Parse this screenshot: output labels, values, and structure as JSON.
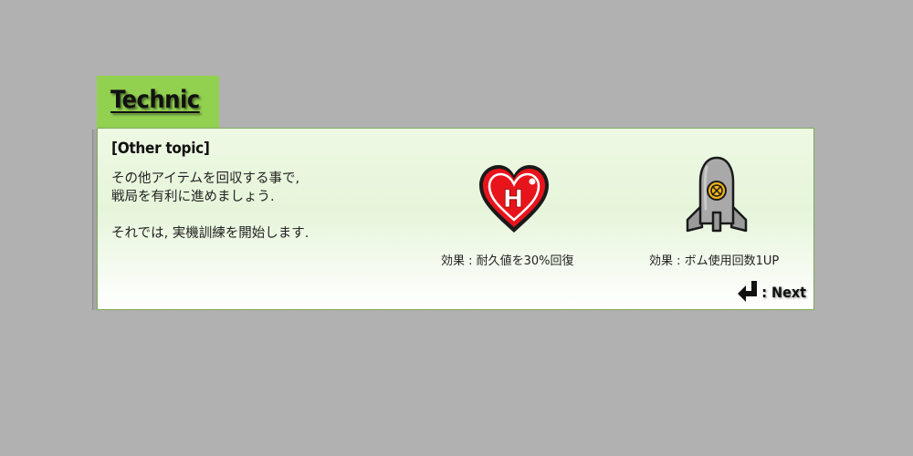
{
  "tab": {
    "title": "Technic",
    "color": "#92d050"
  },
  "panel": {
    "topic": "[Other topic]",
    "body": [
      "その他アイテムを回収する事で,",
      "戦局を有利に進めましょう.",
      "",
      "それでは, 実機訓練を開始します."
    ],
    "items": [
      {
        "icon": "heart-h-icon",
        "letter": "H",
        "caption": "効果 : 耐久値を30%回復"
      },
      {
        "icon": "bomb-icon",
        "caption": "効果 : ボム使用回数1UP"
      }
    ],
    "next": {
      "icon": "return-arrow-icon",
      "label": ": Next"
    }
  },
  "colors": {
    "background": "#b1b1b1",
    "heart": "#e8141c",
    "bomb_body": "#a9a9a9",
    "bomb_core": "#f2b418"
  }
}
